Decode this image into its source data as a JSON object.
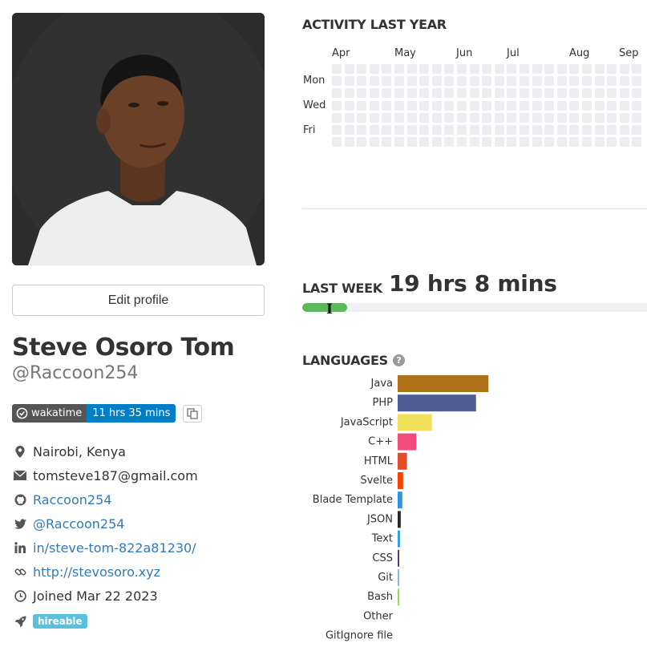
{
  "profile": {
    "edit_label": "Edit profile",
    "full_name": "Steve Osoro Tom",
    "username": "@Raccoon254",
    "badge": {
      "left": "wakatime",
      "right": "11 hrs 35 mins"
    },
    "details": [
      {
        "icon": "map-marker-icon",
        "text": "Nairobi, Kenya",
        "link": false
      },
      {
        "icon": "envelope-icon",
        "text": "tomsteve187@gmail.com",
        "link": false
      },
      {
        "icon": "github-icon",
        "text": "Raccoon254",
        "link": true
      },
      {
        "icon": "twitter-icon",
        "text": "@Raccoon254",
        "link": true
      },
      {
        "icon": "linkedin-icon",
        "text": "in/steve-tom-822a81230/",
        "link": true
      },
      {
        "icon": "link-icon",
        "text": "http://stevosoro.xyz",
        "link": true
      },
      {
        "icon": "clock-icon",
        "text": "Joined Mar 22 2023",
        "link": false
      }
    ],
    "hireable": "hireable",
    "colors": {
      "link": "#337ab7",
      "badge_left": "#555555",
      "badge_right": "#007ec6",
      "hireable": "#5bc0de"
    }
  },
  "activity": {
    "title": "ACTIVITY LAST YEAR",
    "months": [
      "Apr",
      "May",
      "Jun",
      "Jul",
      "Aug",
      "Sep"
    ],
    "days": [
      "Mon",
      "Wed",
      "Fri"
    ],
    "empty_color": "#ebedf0"
  },
  "last_week": {
    "title": "LAST WEEK",
    "value": "19 hrs 8 mins",
    "progress_fraction": 0.13,
    "bar_color": "#5cb85c"
  },
  "languages": {
    "title": "LANGUAGES",
    "help_icon": "question-circle-icon"
  },
  "chart_data": {
    "type": "bar",
    "orientation": "horizontal",
    "title": "LANGUAGES",
    "categories": [
      "Java",
      "PHP",
      "JavaScript",
      "C++",
      "HTML",
      "Svelte",
      "Blade Template",
      "JSON",
      "Text",
      "CSS",
      "Git",
      "Bash",
      "Other",
      "GitIgnore file"
    ],
    "values": [
      117,
      101,
      44,
      24,
      12,
      7,
      6,
      4,
      3,
      2,
      1,
      1,
      0,
      0
    ],
    "colors": [
      "#b07219",
      "#4f5d95",
      "#f1e05a",
      "#f34b7d",
      "#e34c26",
      "#ff3e00",
      "#2b97e5",
      "#292929",
      "#2d9fe0",
      "#563d7c",
      "#86b8e0",
      "#89e051",
      "#cccccc",
      "#cccccc"
    ],
    "xlim": [
      0,
      310
    ],
    "grid": false,
    "legend": "none"
  }
}
